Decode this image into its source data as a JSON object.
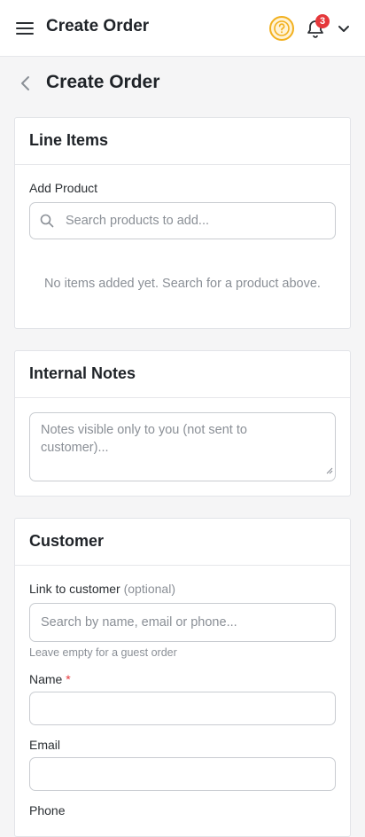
{
  "topbar": {
    "title": "Create Order",
    "notification_count": "3",
    "icons": {
      "menu": "hamburger-menu-icon",
      "help": "help-circle-icon",
      "bell": "bell-icon",
      "account": "chevron-down-icon"
    },
    "help_color": "#f2b01e",
    "badge_color": "#e5383b"
  },
  "page": {
    "title": "Create Order"
  },
  "line_items": {
    "title": "Line Items",
    "add_product_label": "Add Product",
    "search_placeholder": "Search products to add...",
    "empty_message": "No items added yet. Search for a product above."
  },
  "internal_notes": {
    "title": "Internal Notes",
    "placeholder": "Notes visible only to you (not sent to customer)..."
  },
  "customer": {
    "title": "Customer",
    "link_label": "Link to customer",
    "link_optional": "(optional)",
    "link_placeholder": "Search by name, email or phone...",
    "link_hint": "Leave empty for a guest order",
    "name_label": "Name",
    "name_required": "*",
    "name_value": "",
    "email_label": "Email",
    "email_value": "",
    "phone_label": "Phone"
  }
}
